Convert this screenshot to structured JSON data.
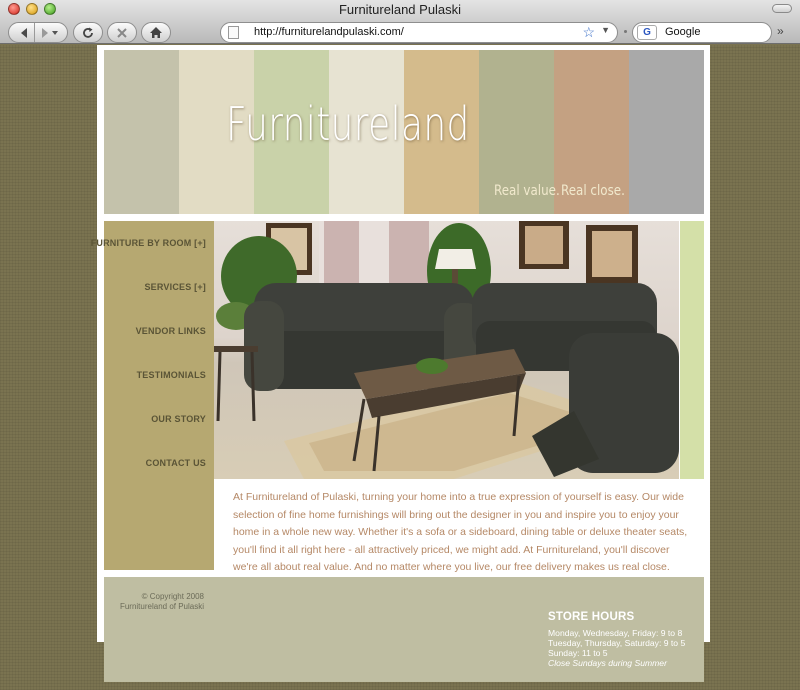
{
  "window": {
    "title": "Furnitureland Pulaski"
  },
  "toolbar": {
    "url": "http://furniturelandpulaski.com/",
    "search_engine": "G",
    "search_placeholder": "Google"
  },
  "header": {
    "logo_text": "Furnitureland",
    "tagline_left": "Real value.",
    "tagline_right": "Real close.",
    "stripe_colors": [
      "#c4c2ab",
      "#e2dcc4",
      "#c9d2a9",
      "#e7e3d2",
      "#d4bb8c",
      "#b1b28f",
      "#c4a182",
      "#a9a9a9"
    ]
  },
  "nav": {
    "items": [
      {
        "label": "FURNITURE BY ROOM [+]"
      },
      {
        "label": "SERVICES [+]"
      },
      {
        "label": "VENDOR LINKS"
      },
      {
        "label": "TESTIMONIALS"
      },
      {
        "label": "OUR STORY"
      },
      {
        "label": "CONTACT US"
      }
    ]
  },
  "content": {
    "intro": "At Furnitureland of Pulaski, turning your home into a true expression of yourself is easy. Our wide selection of fine home furnishings will bring out the designer in you and inspire you to enjoy your home in a whole new way. Whether it's a sofa or a sideboard, dining table or deluxe theater seats, you'll find it all right here - all attractively priced, we might add. At Furnitureland, you'll discover we're all about real value. And no matter where you live, our free delivery makes us real close."
  },
  "footer": {
    "copyright_line1": "© Copyright 2008",
    "copyright_line2": "Furnitureland of Pulaski",
    "hours_title": "STORE HOURS",
    "hours": [
      "Monday, Wednesday, Friday: 9 to 8",
      "Tuesday, Thursday, Saturday: 9 to 5",
      "Sunday: 11 to 5"
    ],
    "hours_note": "Close Sundays during Summer"
  },
  "colors": {
    "sidebar": "#b6a871",
    "footer": "#bfbea2",
    "intro_text": "#b58866",
    "accent_green": "#d4e0a8",
    "page_background": "#7a7350"
  }
}
